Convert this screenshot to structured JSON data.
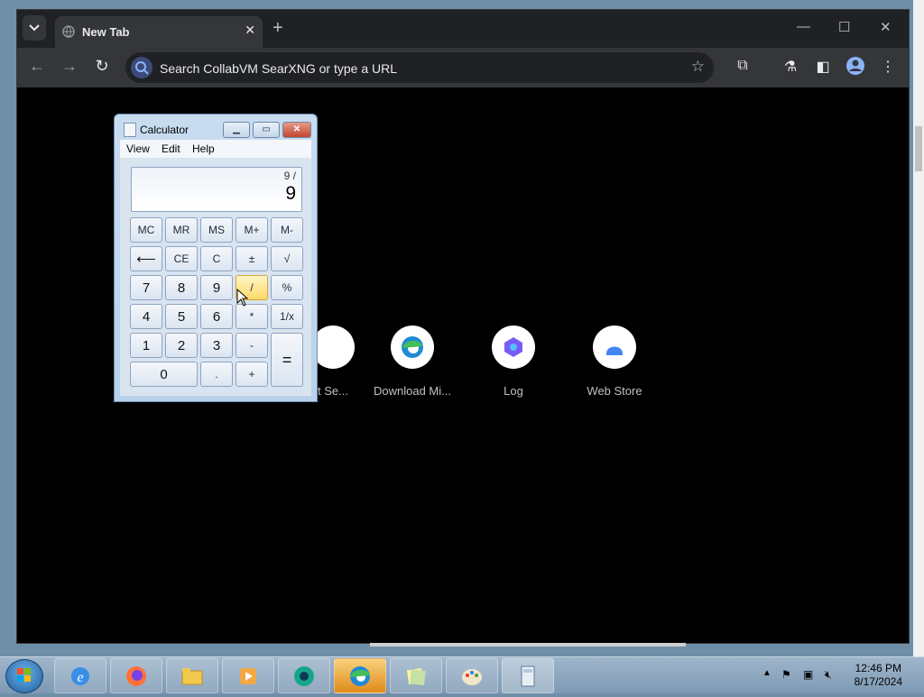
{
  "browser": {
    "tab": {
      "title": "New Tab"
    },
    "omnibox": {
      "placeholder": "Search CollabVM SearXNG or type a URL"
    },
    "shortcuts": [
      {
        "label": "t Se..."
      },
      {
        "label": "Download Mi..."
      },
      {
        "label": "Log"
      },
      {
        "label": "Web Store"
      }
    ]
  },
  "calculator": {
    "title": "Calculator",
    "menu": [
      "View",
      "Edit",
      "Help"
    ],
    "display": {
      "expression": "9 /",
      "value": "9"
    },
    "memory_row": [
      "MC",
      "MR",
      "MS",
      "M+",
      "M-"
    ],
    "row2": [
      "⟵",
      "CE",
      "C",
      "±",
      "√"
    ],
    "row3": [
      "7",
      "8",
      "9",
      "/",
      "%"
    ],
    "row4": [
      "4",
      "5",
      "6",
      "*",
      "1/x"
    ],
    "row5": [
      "1",
      "2",
      "3",
      "-",
      "="
    ],
    "row6": [
      "0",
      ".",
      "+"
    ]
  },
  "taskbar": {
    "clock_time": "12:46 PM",
    "clock_date": "8/17/2024"
  }
}
